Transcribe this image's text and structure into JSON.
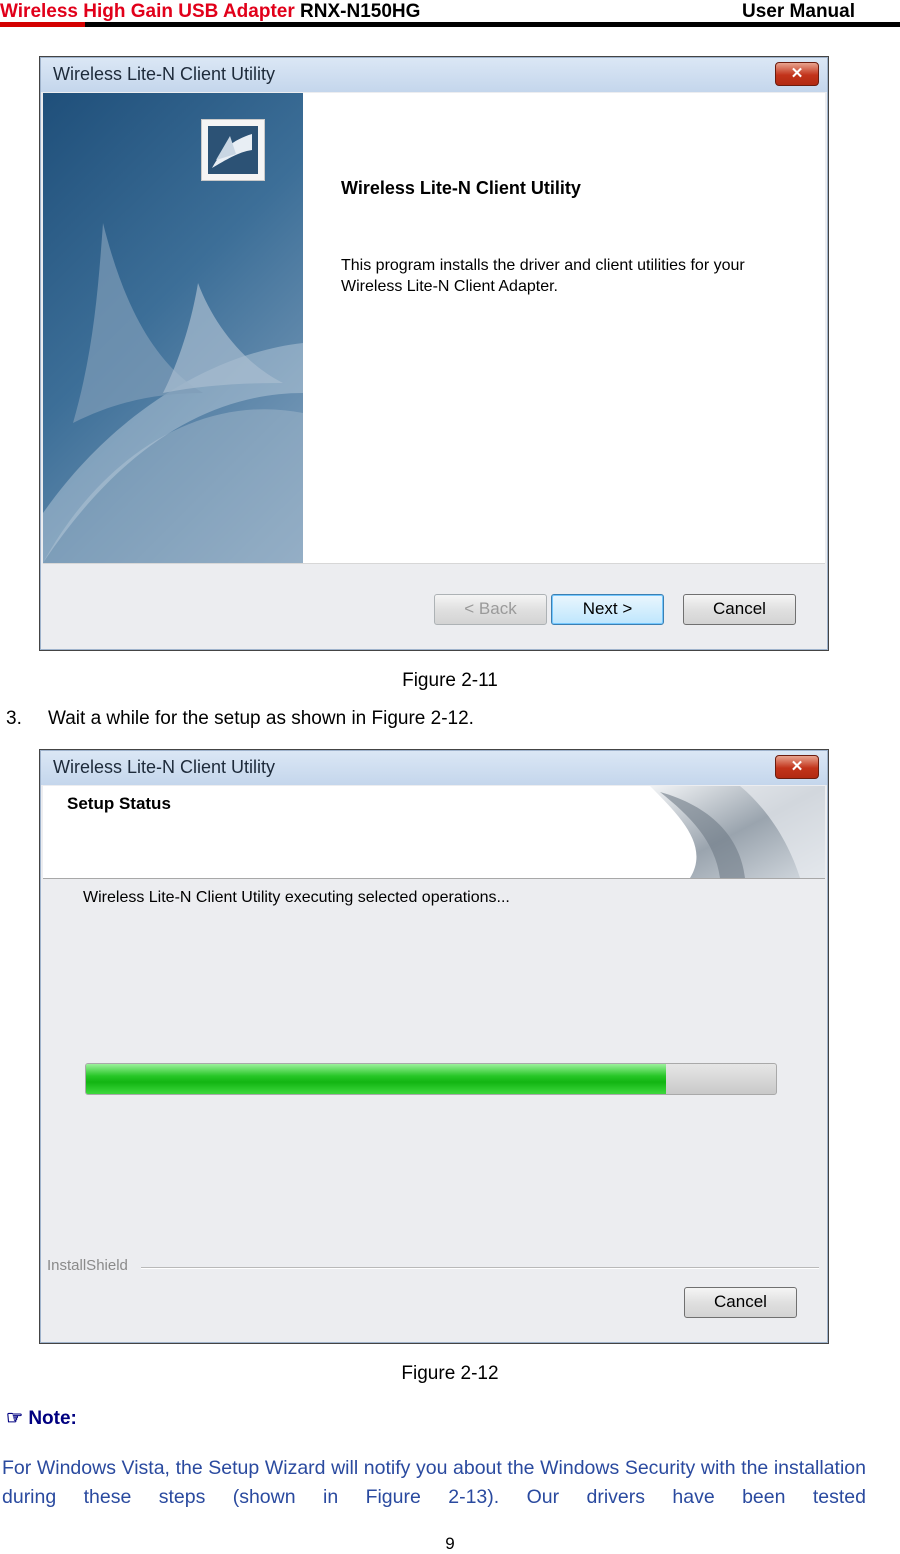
{
  "header": {
    "product": "Wireless High Gain USB Adapter",
    "model": "RNX-N150HG",
    "doc_type": "User Manual"
  },
  "figure1": {
    "window_title": "Wireless Lite-N Client Utility",
    "close_label": "✕",
    "heading": "Wireless Lite-N Client Utility",
    "description": "This program installs the driver and client utilities for your Wireless Lite-N Client Adapter.",
    "buttons": {
      "back": "< Back",
      "next": "Next >",
      "cancel": "Cancel"
    },
    "caption": "Figure 2-11"
  },
  "step": {
    "number": "3.",
    "text": "Wait a while for the setup as shown in Figure 2-12."
  },
  "figure2": {
    "window_title": "Wireless Lite-N Client Utility",
    "close_label": "✕",
    "section_title": "Setup Status",
    "status_message": "Wireless Lite-N Client Utility executing selected operations...",
    "progress_percent": 84,
    "group_label": "InstallShield",
    "buttons": {
      "cancel": "Cancel"
    },
    "caption": "Figure 2-12"
  },
  "note": {
    "icon": "pointing-hand-icon",
    "glyph": "☞",
    "label": "Note:",
    "text": "For Windows Vista, the Setup Wizard will notify you about the Windows Security with the installation during these steps (shown in Figure 2-13). Our drivers have been tested"
  },
  "page_number": "9"
}
